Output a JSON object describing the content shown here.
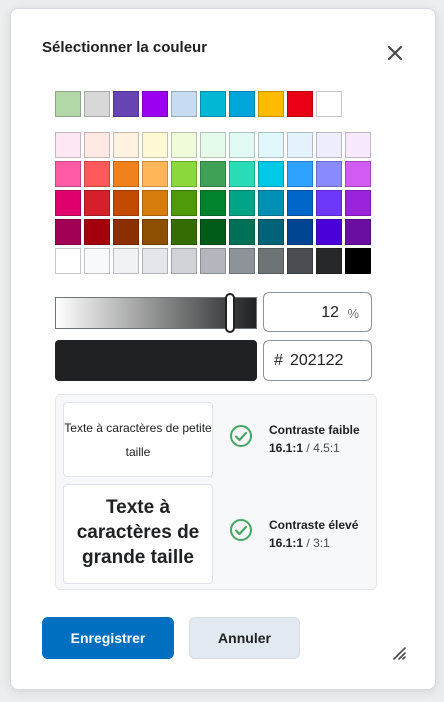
{
  "dialog": {
    "title": "Sélectionner la couleur"
  },
  "icons": {
    "close": "close-icon",
    "check": "check-circle-icon",
    "resize": "resize-handle-icon"
  },
  "top_swatches": [
    "#b2d8a8",
    "#d8d8d8",
    "#6843b4",
    "#9c00f0",
    "#c6dcf3",
    "#00b8d4",
    "#00a6d9",
    "#ffbb00",
    "#e90017",
    "#ffffff"
  ],
  "palette": [
    [
      "#ffe8f5",
      "#ffe9e5",
      "#fff2e0",
      "#fff9d6",
      "#f0fbda",
      "#e5faea",
      "#e1faf5",
      "#e0f7fb",
      "#e5f3ff",
      "#eeeeff",
      "#f8e9ff"
    ],
    [
      "#ff5ba5",
      "#ff5a5a",
      "#f0821e",
      "#ffb658",
      "#8ad83c",
      "#3fa158",
      "#2bdcb8",
      "#00c8e6",
      "#2fa2ff",
      "#8a8aff",
      "#d25bf3"
    ],
    [
      "#e0006b",
      "#d51f2a",
      "#c24b00",
      "#d67d0b",
      "#4e9a0a",
      "#00822e",
      "#00a487",
      "#008fb4",
      "#0065c8",
      "#6d38fa",
      "#9b23da"
    ],
    [
      "#a20055",
      "#a2000c",
      "#8b2e00",
      "#8d4f00",
      "#356c03",
      "#005a18",
      "#007056",
      "#006277",
      "#004591",
      "#4a00d9",
      "#6a0da0"
    ],
    [
      "#ffffff",
      "#f8f9fc",
      "#f0f2f6",
      "#e3e6ea",
      "#d0d3d8",
      "#b3b7bd",
      "#8e939a",
      "#6e7376",
      "#4a4e52",
      "#262829",
      "#000000"
    ]
  ],
  "slider": {
    "level_percent": 88
  },
  "lightness": {
    "value": "12",
    "unit": "%"
  },
  "color": {
    "hex_prefix": "#",
    "hex": "202122",
    "current": "#202122"
  },
  "contrast": {
    "small_sample": "Texte à caractères de petite taille",
    "large_sample": "Texte à caractères de grande taille",
    "low": {
      "label": "Contraste faible",
      "ratio": "16.1:1",
      "sep": "/",
      "required": "4.5:1"
    },
    "high": {
      "label": "Contraste élevé",
      "ratio": "16.1:1",
      "sep": "/",
      "required": "3:1"
    }
  },
  "buttons": {
    "save": "Enregistrer",
    "cancel": "Annuler"
  },
  "colors": {
    "accent": "#006fbf",
    "check": "#46a661",
    "secondary_button": "#e3e9f1"
  }
}
